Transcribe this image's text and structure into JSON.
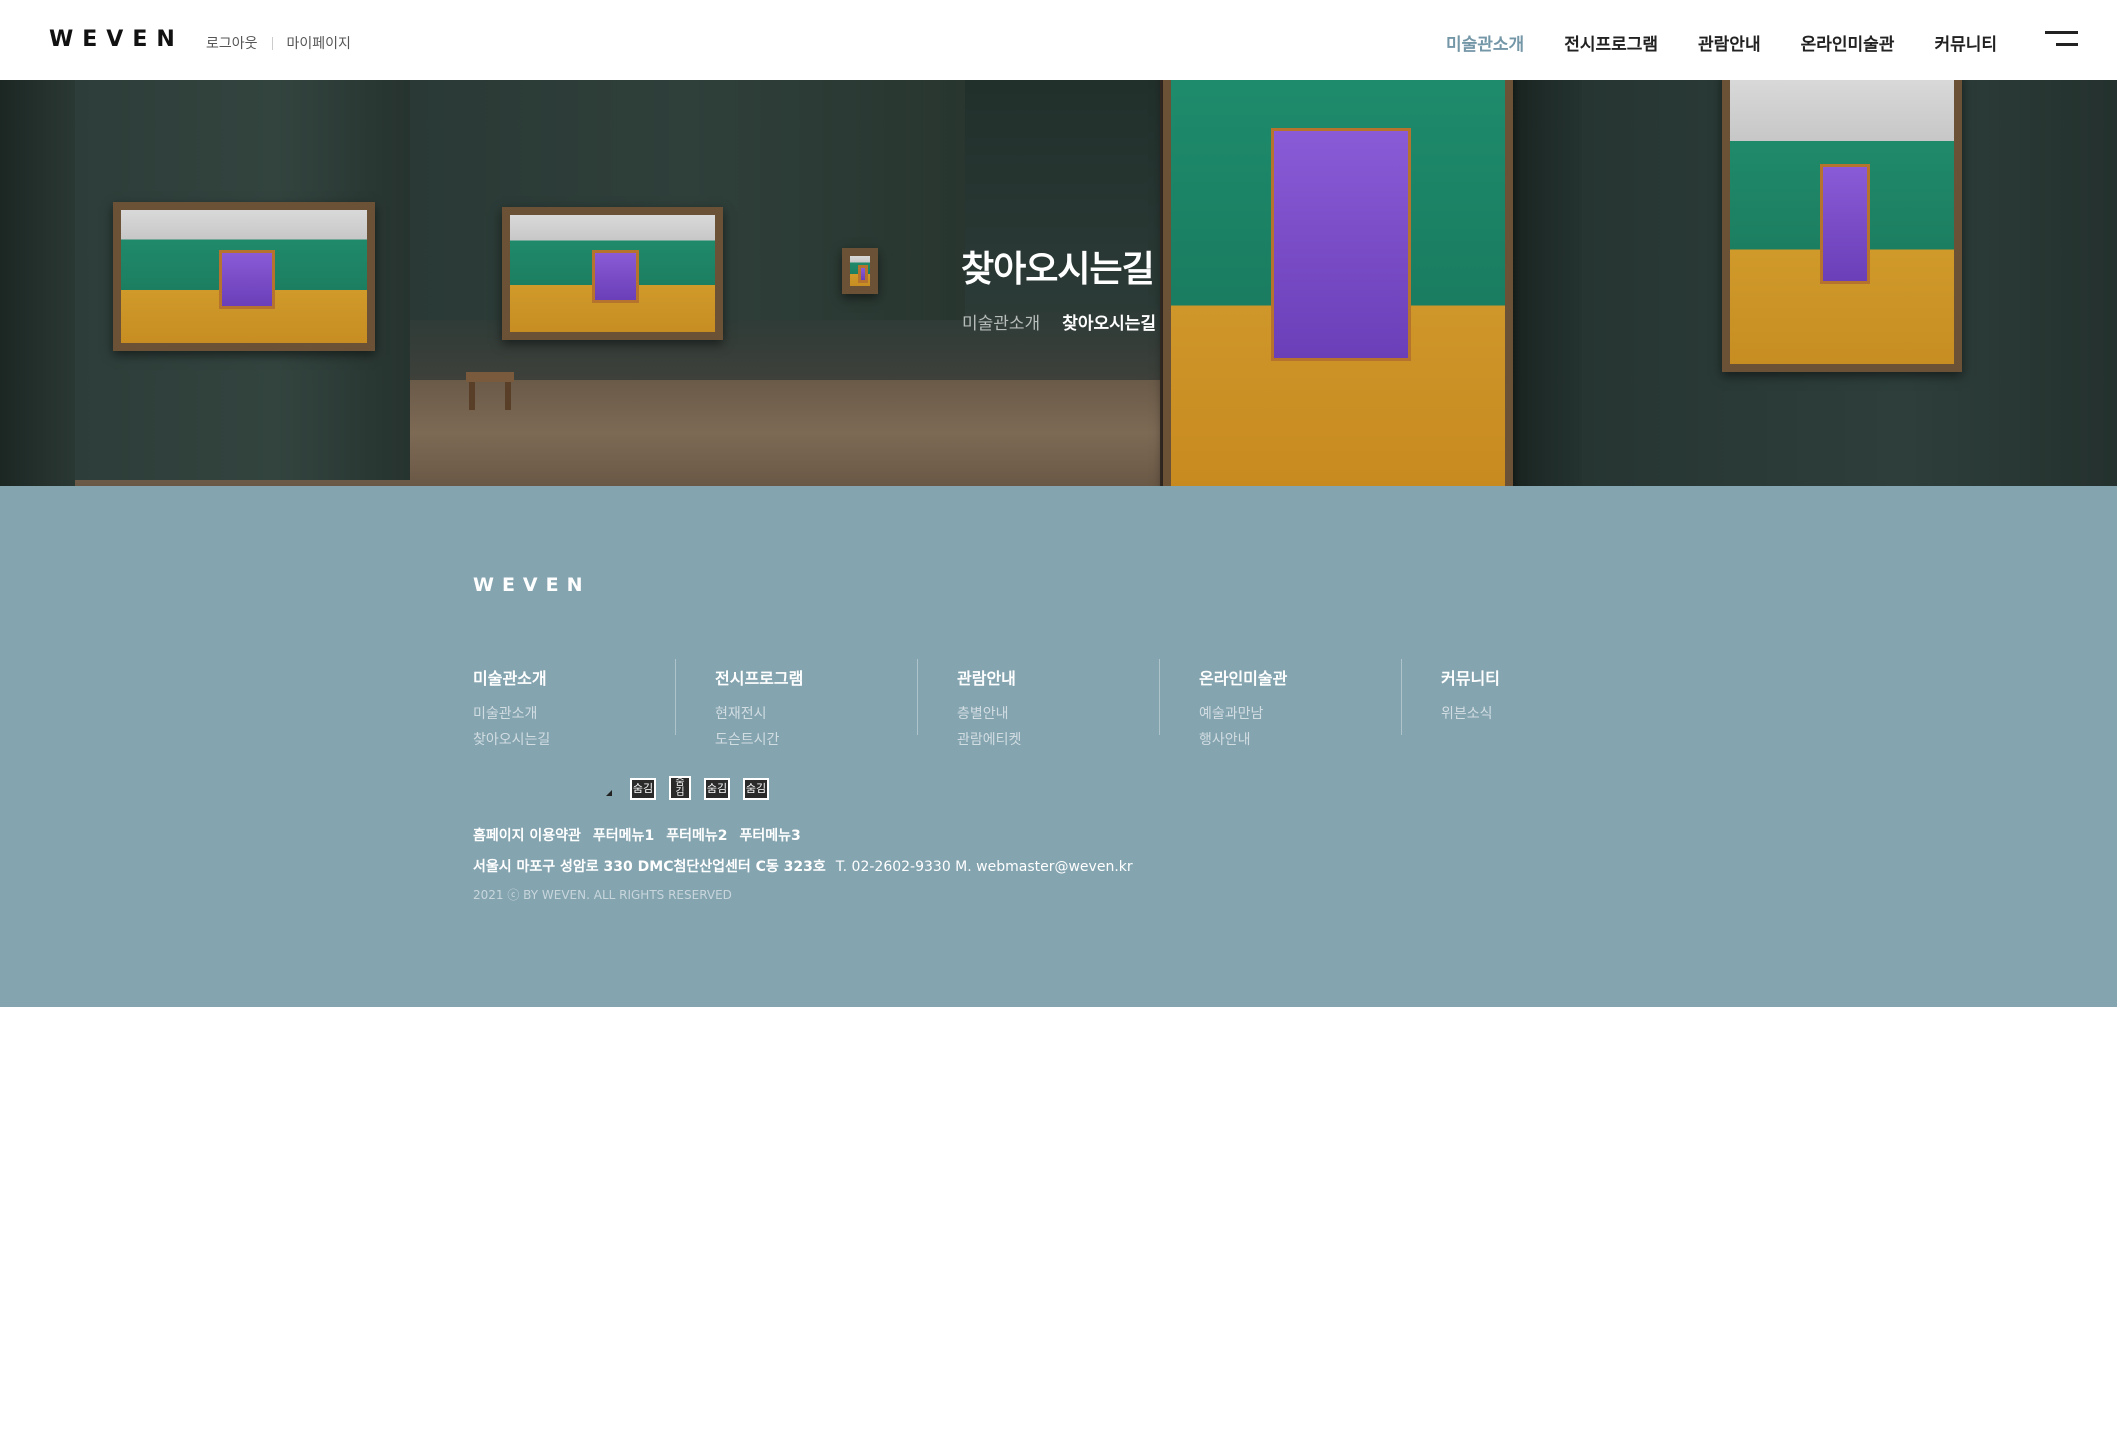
{
  "header": {
    "logo": "WEVEN",
    "util": {
      "logout": "로그아웃",
      "mypage": "마이페이지"
    },
    "nav": [
      "미술관소개",
      "전시프로그램",
      "관람안내",
      "온라인미술관",
      "커뮤니티"
    ],
    "active_index": 0,
    "accent_color": "#7497a8"
  },
  "hero": {
    "title": "찾아오시는길",
    "breadcrumb": [
      "미술관소개",
      "찾아오시는길"
    ]
  },
  "footer": {
    "background": "#84a4b0",
    "logo": "WEVEN",
    "menu": [
      {
        "title": "미술관소개",
        "items": [
          "미술관소개",
          "찾아오시는길"
        ]
      },
      {
        "title": "전시프로그램",
        "items": [
          "현재전시",
          "도슨트시간"
        ]
      },
      {
        "title": "관람안내",
        "items": [
          "층별안내",
          "관람에티켓"
        ]
      },
      {
        "title": "온라인미술관",
        "items": [
          "예술과만남",
          "행사안내"
        ]
      },
      {
        "title": "커뮤니티",
        "items": [
          "위븐소식"
        ]
      }
    ],
    "icons": [
      "숨김",
      "숨김",
      "숨김",
      "숨김"
    ],
    "links": [
      "홈페이지 이용약관",
      "푸터메뉴1",
      "푸터메뉴2",
      "푸터메뉴3"
    ],
    "address": "서울시 마포구 성암로 330 DMC첨단산업센터 C동 323호",
    "contact": "T. 02-2602-9330 M. webmaster@weven.kr",
    "copyright": "2021 ⓒ BY WEVEN. ALL RIGHTS RESERVED"
  }
}
